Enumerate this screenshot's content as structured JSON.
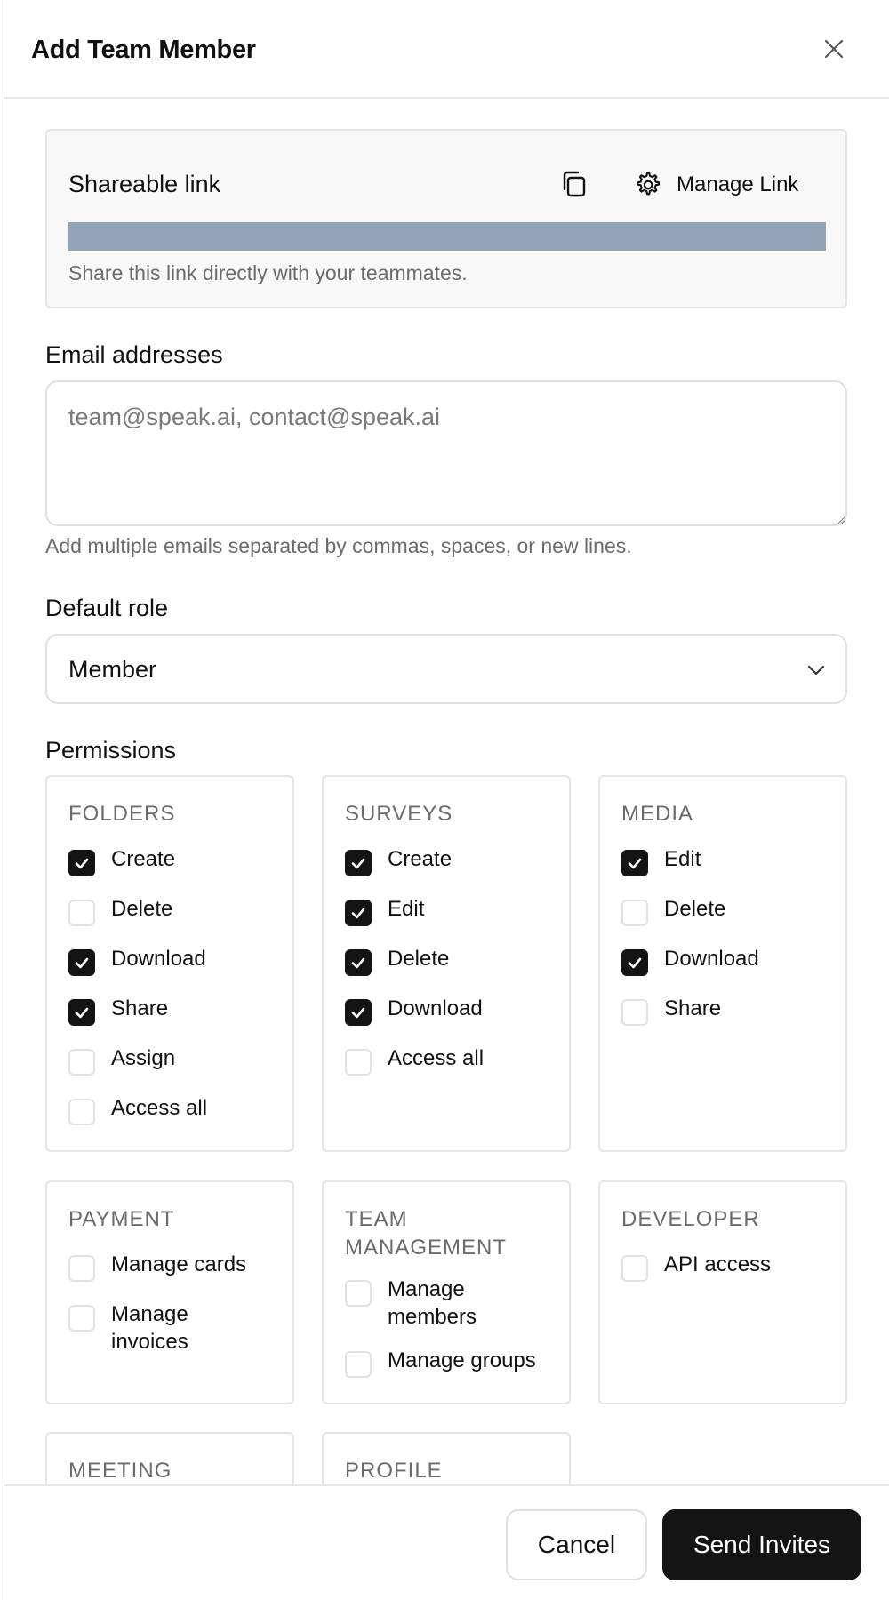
{
  "header": {
    "title": "Add Team Member"
  },
  "share": {
    "title": "Shareable link",
    "manage_label": "Manage Link",
    "help": "Share this link directly with your teammates."
  },
  "emails": {
    "label": "Email addresses",
    "value": "",
    "placeholder": "team@speak.ai, contact@speak.ai",
    "help": "Add multiple emails separated by commas, spaces, or new lines."
  },
  "role": {
    "label": "Default role",
    "value": "Member"
  },
  "permissions": {
    "label": "Permissions",
    "groups": [
      {
        "title": "FOLDERS",
        "items": [
          {
            "label": "Create",
            "checked": true
          },
          {
            "label": "Delete",
            "checked": false
          },
          {
            "label": "Download",
            "checked": true
          },
          {
            "label": "Share",
            "checked": true
          },
          {
            "label": "Assign",
            "checked": false
          },
          {
            "label": "Access all",
            "checked": false
          }
        ]
      },
      {
        "title": "SURVEYS",
        "items": [
          {
            "label": "Create",
            "checked": true
          },
          {
            "label": "Edit",
            "checked": true
          },
          {
            "label": "Delete",
            "checked": true
          },
          {
            "label": "Download",
            "checked": true
          },
          {
            "label": "Access all",
            "checked": false
          }
        ]
      },
      {
        "title": "MEDIA",
        "items": [
          {
            "label": "Edit",
            "checked": true
          },
          {
            "label": "Delete",
            "checked": false
          },
          {
            "label": "Download",
            "checked": true
          },
          {
            "label": "Share",
            "checked": false
          }
        ]
      },
      {
        "title": "PAYMENT",
        "items": [
          {
            "label": "Manage cards",
            "checked": false
          },
          {
            "label": "Manage invoices",
            "checked": false
          }
        ]
      },
      {
        "title": "TEAM MANAGEMENT",
        "items": [
          {
            "label": "Manage members",
            "checked": false
          },
          {
            "label": "Manage groups",
            "checked": false
          }
        ]
      },
      {
        "title": "DEVELOPER",
        "items": [
          {
            "label": "API access",
            "checked": false
          }
        ]
      },
      {
        "title": "MEETING",
        "items": []
      },
      {
        "title": "PROFILE",
        "items": []
      }
    ]
  },
  "footer": {
    "cancel_label": "Cancel",
    "send_label": "Send Invites"
  },
  "colors": {
    "accent": "#141414",
    "link_bar": "#94a3b8",
    "border": "#e5e5e5",
    "muted_text": "#6b6b6b"
  },
  "icons": [
    "close-icon",
    "copy-icon",
    "gear-icon",
    "chevron-down-icon",
    "check-icon"
  ]
}
